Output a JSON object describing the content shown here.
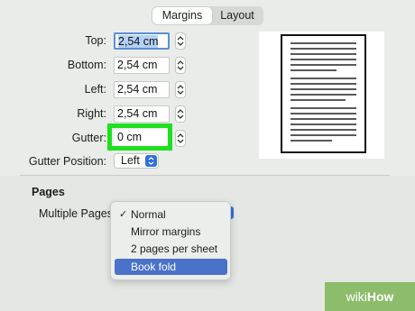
{
  "tabs": [
    {
      "label": "Margins",
      "active": true
    },
    {
      "label": "Layout",
      "active": false
    }
  ],
  "margins": {
    "top": {
      "label": "Top:",
      "value": "2,54 cm"
    },
    "bottom": {
      "label": "Bottom:",
      "value": "2,54 cm"
    },
    "left": {
      "label": "Left:",
      "value": "2,54 cm"
    },
    "right": {
      "label": "Right:",
      "value": "2,54 cm"
    },
    "gutter": {
      "label": "Gutter:",
      "value": "0 cm"
    },
    "gutter_position": {
      "label": "Gutter Position:",
      "value": "Left"
    }
  },
  "pages": {
    "title": "Pages",
    "multiple_pages_label": "Multiple Pages",
    "menu": [
      {
        "label": "Normal",
        "checked": true,
        "highlighted": false
      },
      {
        "label": "Mirror margins",
        "checked": false,
        "highlighted": false
      },
      {
        "label": "2 pages per sheet",
        "checked": false,
        "highlighted": false
      },
      {
        "label": "Book fold",
        "checked": false,
        "highlighted": true
      }
    ]
  },
  "colors": {
    "highlight_box": "#1fe01f",
    "accent_blue": "#2f6fe0",
    "menu_highlight": "#4a72c8",
    "watermark": "#8dbd6b"
  },
  "icons": {
    "stepper": "stepper-arrows-icon",
    "checkmark": "checkmark-icon",
    "select_arrow": "chevron-updown-icon"
  },
  "watermark": {
    "wiki": "wiki",
    "how": "How"
  }
}
